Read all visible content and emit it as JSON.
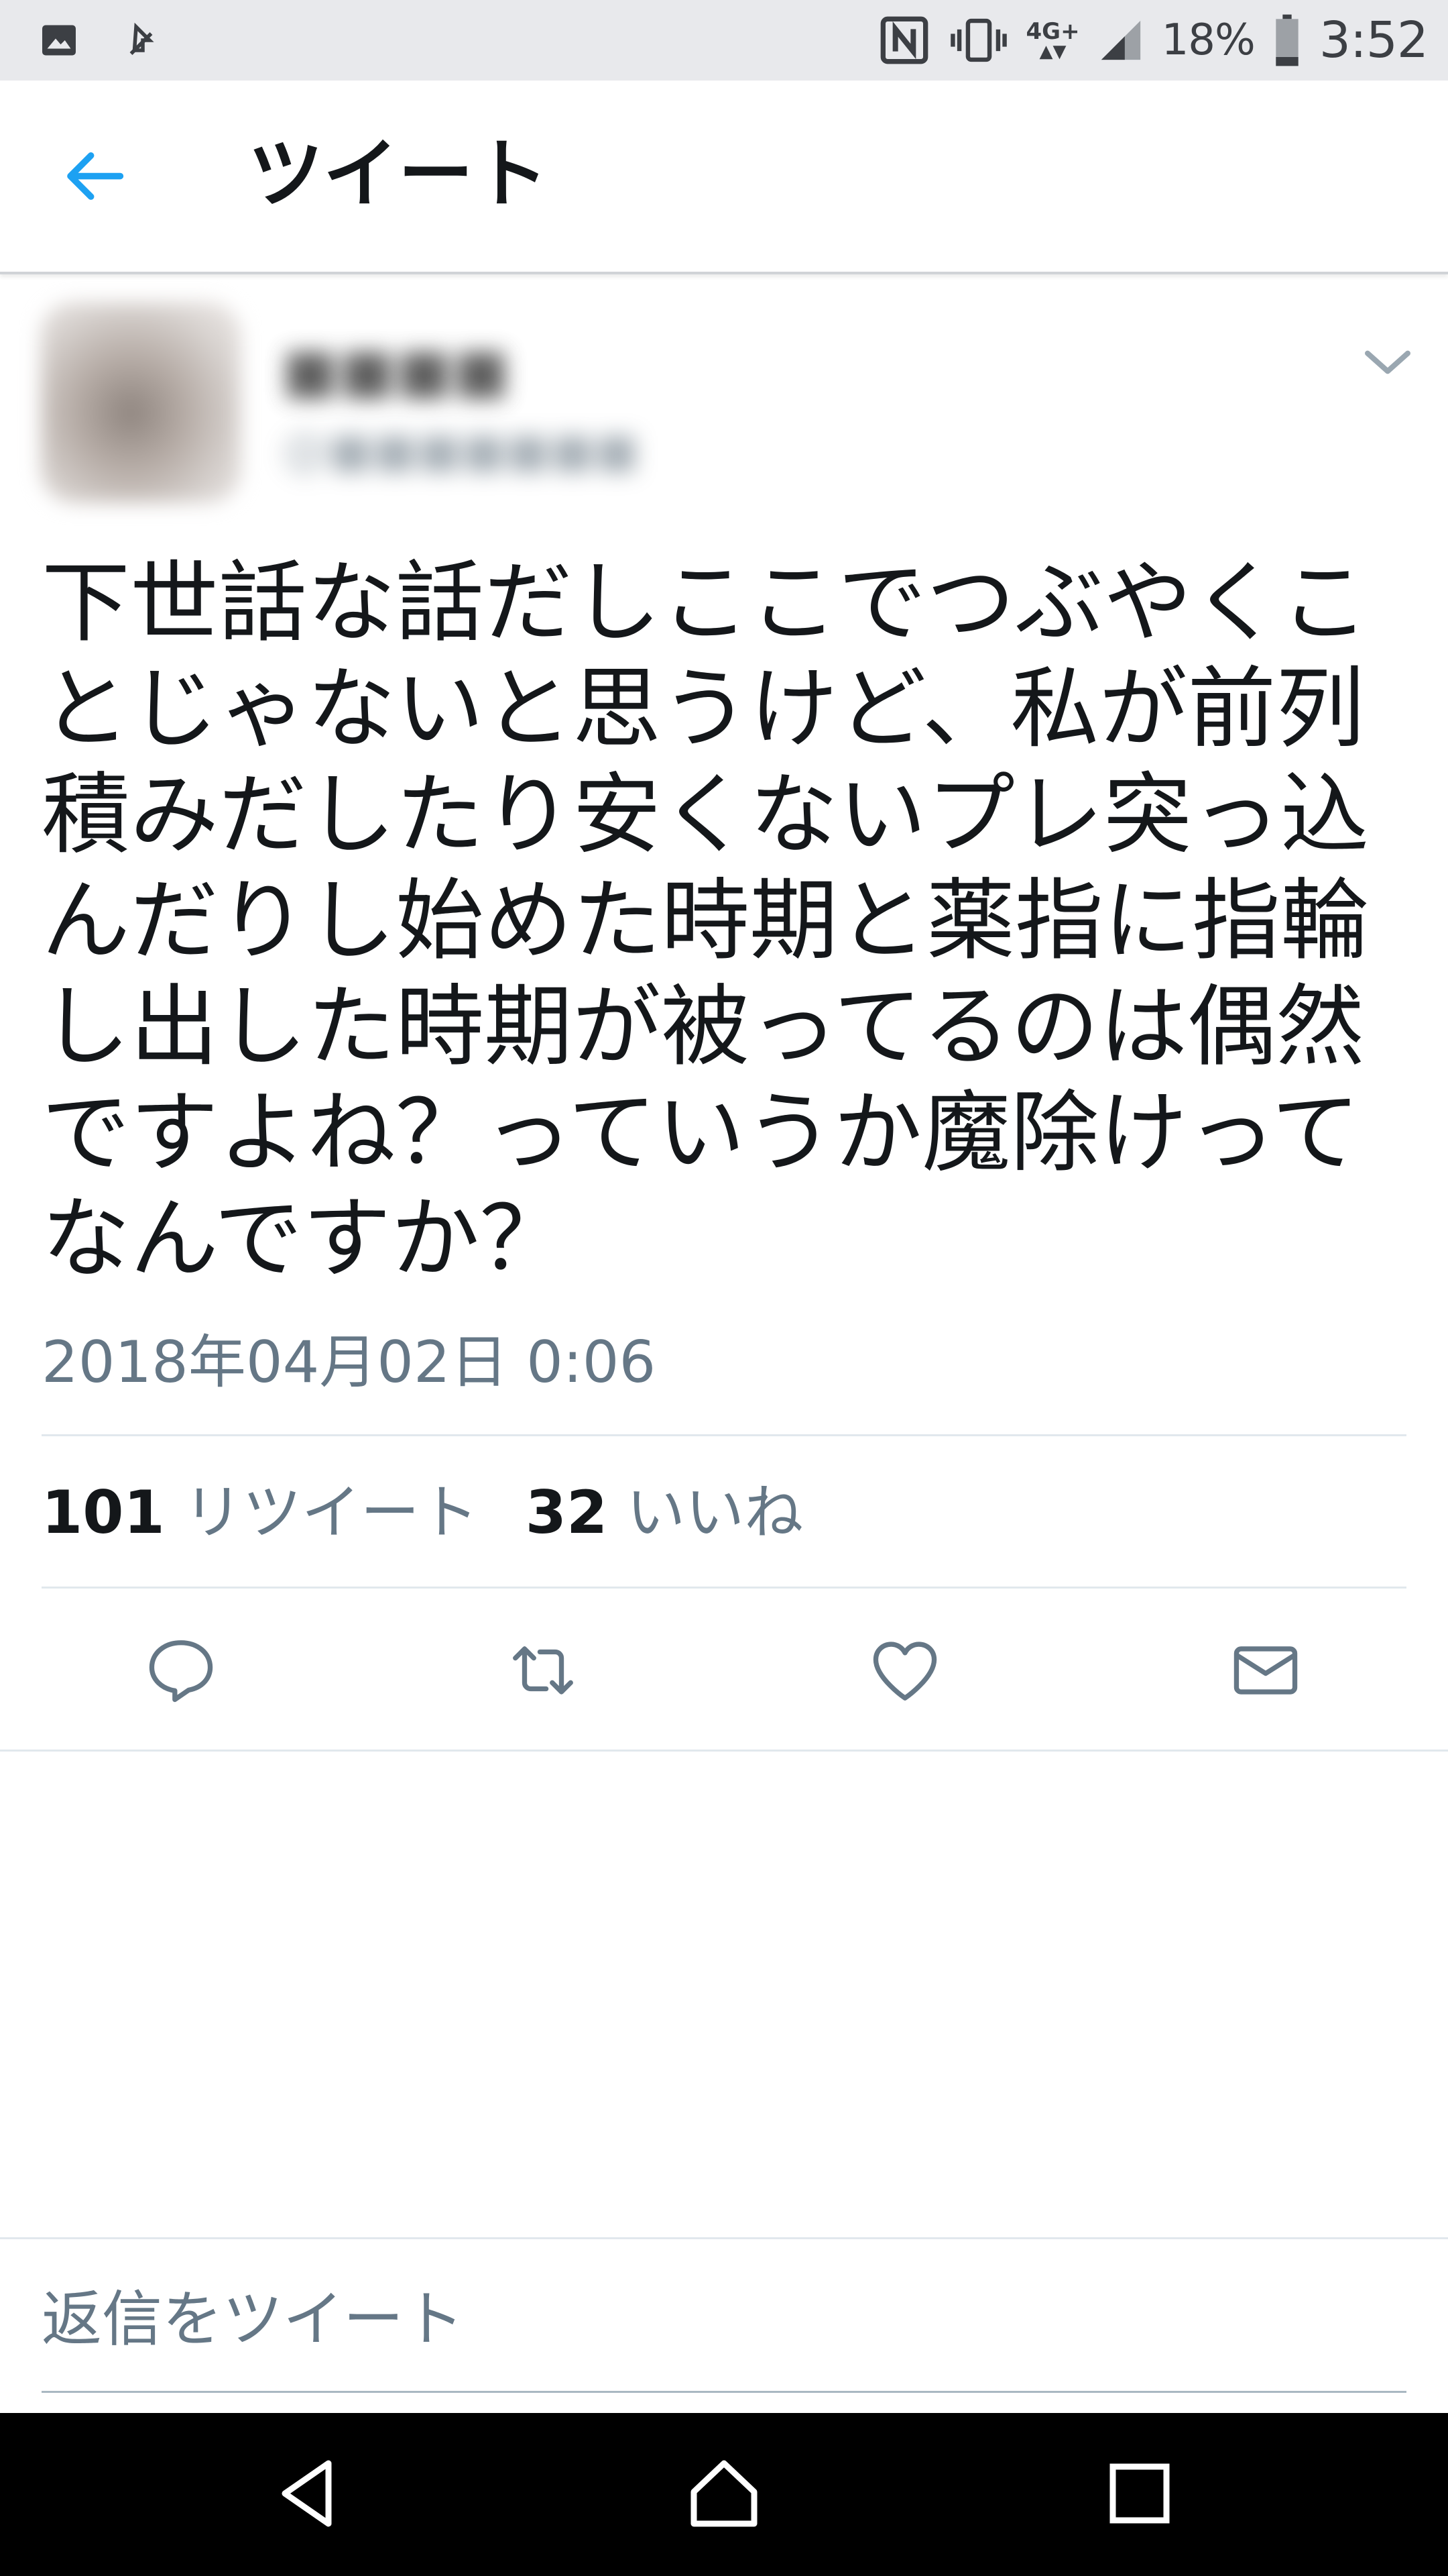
{
  "status_bar": {
    "left_icons": [
      "image-icon",
      "download-icon"
    ],
    "right_icons": [
      "nfc-icon",
      "vibrate-icon",
      "signal-icon",
      "battery-icon"
    ],
    "network_type": "4G+",
    "battery_percent": "18%",
    "time": "3:52"
  },
  "header": {
    "title": "ツイート",
    "back_icon": "arrow-left-icon"
  },
  "tweet": {
    "author_name": "■■■■",
    "author_handle": "@■■■■■■■",
    "text": "下世話な話だしここでつぶやくことじゃないと思うけど、私が前列積みだしたり安くないプレ突っ込んだりし始めた時期と薬指に指輪し出した時期が被ってるのは偶然ですよね？っていうか魔除けってなんですか？",
    "timestamp": "2018年04月02日 0:06",
    "retweet_count": "101",
    "retweet_label": "リツイート",
    "like_count": "32",
    "like_label": "いいね"
  },
  "actions": [
    "reply-icon",
    "retweet-icon",
    "like-icon",
    "message-icon"
  ],
  "reply": {
    "placeholder": "返信をツイート"
  },
  "colors": {
    "accent": "#1da1f2",
    "text_primary": "#14171a",
    "text_secondary": "#657786",
    "divider": "#e1e8ed",
    "status_bar_bg": "#e8e9ec",
    "nav_bar_bg": "#000000"
  }
}
